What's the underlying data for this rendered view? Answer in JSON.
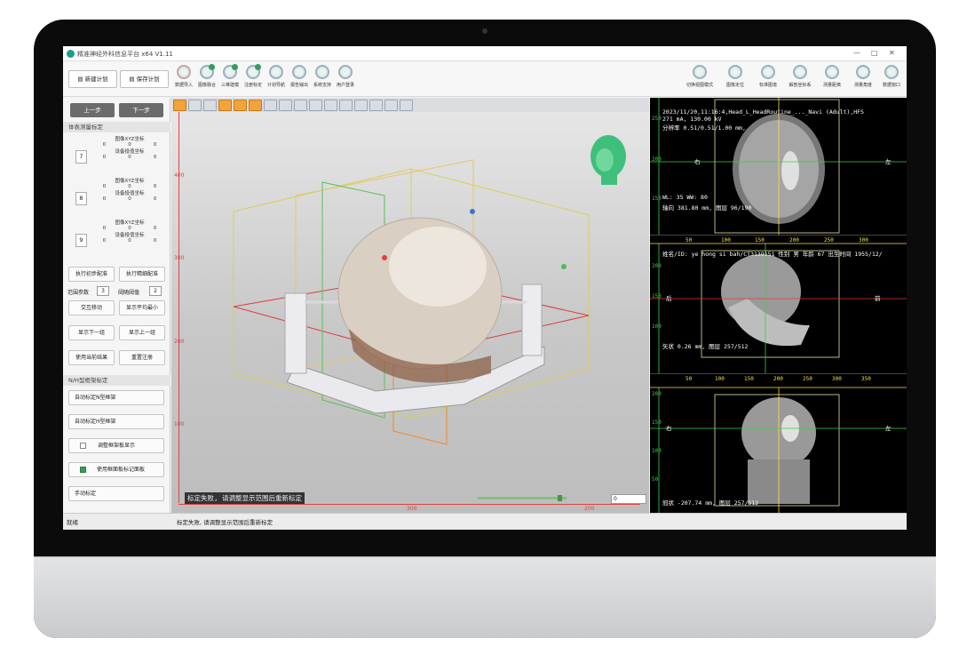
{
  "window": {
    "title": "精准神经外科信息平台 x64 V1.11",
    "controls": [
      "—",
      "□",
      "✕"
    ]
  },
  "toolbar": {
    "new_plan": "新建计划",
    "save_plan": "保存计划",
    "left_tools": [
      {
        "label": "数据导入",
        "icon": "download-icon",
        "checked": false
      },
      {
        "label": "图像融合",
        "icon": "refresh-icon",
        "checked": true
      },
      {
        "label": "三维建模",
        "icon": "refresh-icon",
        "checked": true
      },
      {
        "label": "注册标定",
        "icon": "refresh-icon",
        "checked": true
      },
      {
        "label": "计划导航",
        "icon": "refresh-icon",
        "checked": false
      },
      {
        "label": "报告输出",
        "icon": "refresh-icon",
        "checked": false
      },
      {
        "label": "系统支持",
        "icon": "refresh-icon",
        "checked": false
      },
      {
        "label": "用户登录",
        "icon": "refresh-icon",
        "checked": false
      }
    ],
    "right_tools": [
      {
        "label": "切换视图模式",
        "icon": "refresh-icon"
      },
      {
        "label": "图像定位",
        "icon": "refresh-icon"
      },
      {
        "label": "标准图谱",
        "icon": "refresh-icon"
      },
      {
        "label": "解剖坐标系",
        "icon": "refresh-icon"
      },
      {
        "label": "测量距离",
        "icon": "refresh-icon"
      },
      {
        "label": "测量角度",
        "icon": "refresh-icon"
      },
      {
        "label": "数据窗口",
        "icon": "refresh-icon"
      }
    ]
  },
  "left_panel": {
    "prev_step": "上一步",
    "next_step": "下一步",
    "section_fiducial": "体表测量标定",
    "points": [
      {
        "num": "7",
        "image_label": "图像XYZ坐标",
        "image_vals": [
          "0",
          "0",
          "0"
        ],
        "device_label": "设备投值坐标",
        "device_vals": [
          "0",
          "0",
          "0"
        ]
      },
      {
        "num": "8",
        "image_label": "图像XYZ坐标",
        "image_vals": [
          "0",
          "0",
          "0"
        ],
        "device_label": "设备投值坐标",
        "device_vals": [
          "0",
          "0",
          "0"
        ]
      },
      {
        "num": "9",
        "image_label": "图像XYZ坐标",
        "image_vals": [
          "0",
          "0",
          "0"
        ],
        "device_label": "设备投值坐标",
        "device_vals": [
          "0",
          "0",
          "0"
        ]
      }
    ],
    "exec_initial": "执行初步配准",
    "exec_fine": "执行精细配准",
    "range_label": "范围参数",
    "range_value": "3",
    "grad_label": "阈随阈值",
    "grad_value": "2",
    "interactive_move": "交互移动",
    "show_avg_min": "显示平均最小",
    "show_next": "显示下一组",
    "show_prev": "显示上一组",
    "use_current": "使用当前结果",
    "reset_registration": "重置注册",
    "section_frame": "N/H型框架标定",
    "auto_n_frame": "自动标定N型框架",
    "auto_h_frame": "自动标定H型框架",
    "adjust_frame_display": "调整框架板显示",
    "use_frame_marker": "使用框面板标记面板",
    "manual_calibration": "手动标定"
  },
  "viewport": {
    "left_ticks": [
      "400",
      "300",
      "200",
      "100"
    ],
    "bottom_ticks": [
      "300",
      "200"
    ],
    "message": "标定失败, 请调整显示范围后重新标定",
    "slider_value": "0.93",
    "slider_input": "0"
  },
  "slices": [
    {
      "header1": "2023/11/20,11:16:4,Head_L_HeadRoutine_..._Navi (Adult),HFS",
      "header2": "271 mA, 130.00 kV",
      "header3": "分辨率 0.51/0.51/1.00 mm,",
      "window": "WL: 35  WW: 80",
      "footer": "轴向 381.80 mm, 图层 96/190",
      "side_left": "右",
      "side_right": "左",
      "y_ticks": [
        "250",
        "200",
        "150"
      ]
    },
    {
      "header1": "姓名/ID: ye hong si bah/CT3139151  性别 男  年龄 67  出生时间 1955/12/",
      "footer": "矢状 0.26 mm, 图层 257/512",
      "side_left": "后",
      "side_right": "前",
      "y_ticks": [
        "200",
        "150",
        "100"
      ],
      "x_ticks": [
        "50",
        "100",
        "150",
        "200",
        "250",
        "300"
      ]
    },
    {
      "footer": "冠状 -207.74 mm, 图层 257/512",
      "side_left": "右",
      "side_right": "左",
      "y_ticks": [
        "200",
        "150",
        "100",
        "50"
      ],
      "x_ticks": [
        "50",
        "100",
        "150",
        "200",
        "250",
        "300",
        "350"
      ]
    }
  ],
  "statusbar": {
    "left": "就绪",
    "message": "标定失败, 请调整显示范围后重新标定"
  }
}
